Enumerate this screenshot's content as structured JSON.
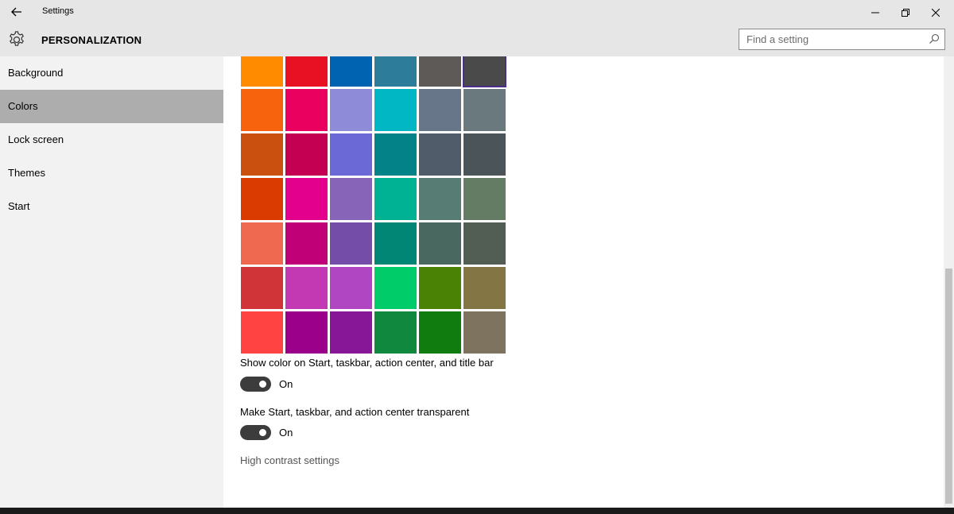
{
  "window": {
    "title": "Settings"
  },
  "header": {
    "section_title": "PERSONALIZATION",
    "search_placeholder": "Find a setting"
  },
  "sidebar": {
    "items": [
      {
        "label": "Background"
      },
      {
        "label": "Colors",
        "selected": true
      },
      {
        "label": "Lock screen"
      },
      {
        "label": "Themes"
      },
      {
        "label": "Start"
      }
    ]
  },
  "colors": {
    "selected_swatch": "#4a4a4a",
    "swatches": [
      [
        "#ff8c00",
        "#e81123",
        "#0063b1",
        "#2d7d9a",
        "#5d5a58",
        "#4a4a4a"
      ],
      [
        "#f7630c",
        "#ea005e",
        "#8e8cd8",
        "#00b7c3",
        "#68768a",
        "#69797e"
      ],
      [
        "#ca5010",
        "#c30052",
        "#6b69d6",
        "#038387",
        "#515c6b",
        "#4a5459"
      ],
      [
        "#da3b01",
        "#e3008c",
        "#8764b8",
        "#00b294",
        "#567c73",
        "#647c64"
      ],
      [
        "#ef6950",
        "#bf0077",
        "#744da9",
        "#018574",
        "#486860",
        "#525e54"
      ],
      [
        "#d13438",
        "#c239b3",
        "#b146c2",
        "#00cc6a",
        "#498205",
        "#847545"
      ],
      [
        "#ff4343",
        "#9a0089",
        "#881798",
        "#10893e",
        "#107c10",
        "#7e735f"
      ]
    ]
  },
  "options": {
    "show_color_label": "Show color on Start, taskbar, action center, and title bar",
    "show_color_state": "On",
    "transparent_label": "Make Start, taskbar, and action center transparent",
    "transparent_state": "On",
    "high_contrast_link": "High contrast settings"
  },
  "icons": {
    "back": "back-arrow-icon",
    "gear": "gear-icon",
    "search": "search-icon"
  }
}
